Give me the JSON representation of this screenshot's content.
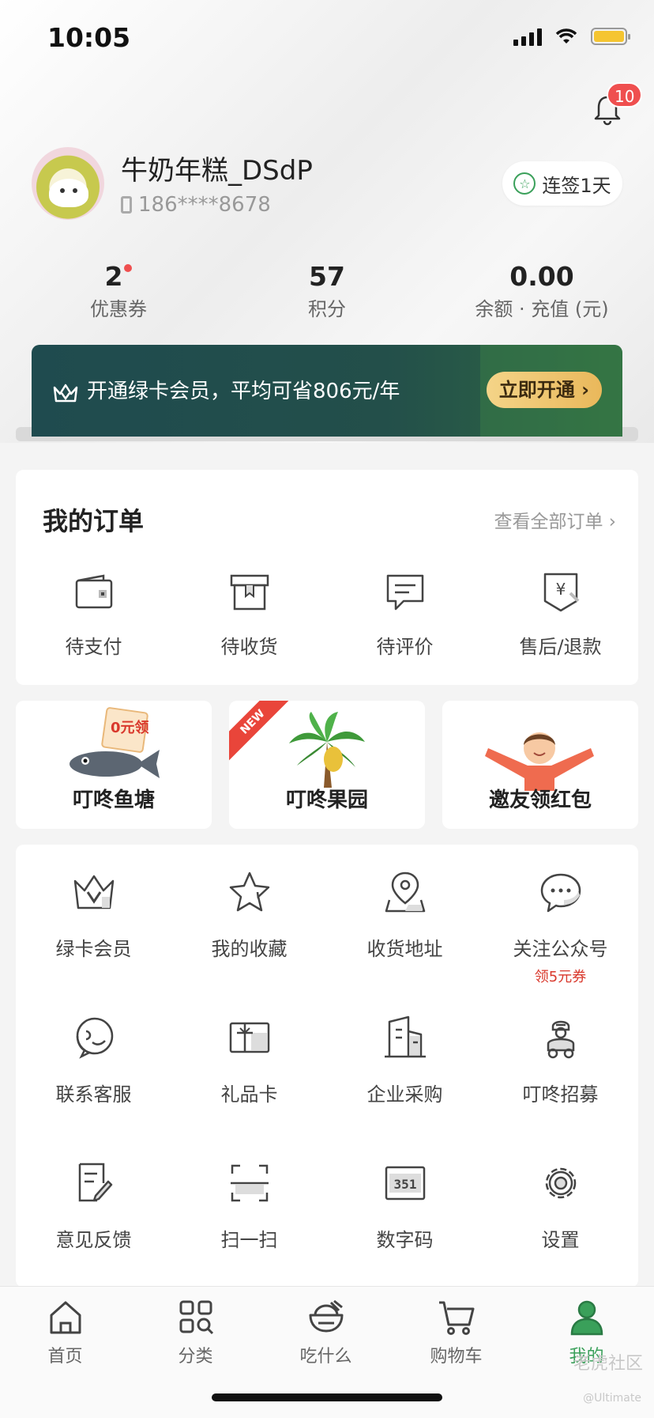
{
  "status_bar": {
    "time": "10:05"
  },
  "notifications": {
    "badge": "10"
  },
  "profile": {
    "name": "牛奶年糕_DSdP",
    "phone": "186****8678",
    "checkin": "连签1天"
  },
  "stats": [
    {
      "value": "2",
      "label": "优惠券",
      "dot": true
    },
    {
      "value": "57",
      "label": "积分"
    },
    {
      "value": "0.00",
      "label": "余额 · 充值 (元)"
    }
  ],
  "member_banner": {
    "text": "开通绿卡会员，平均可省806元/年",
    "button": "立即开通 ›"
  },
  "orders": {
    "title": "我的订单",
    "view_all": "查看全部订单 ›",
    "items": [
      {
        "label": "待支付",
        "icon": "wallet-icon"
      },
      {
        "label": "待收货",
        "icon": "box-icon"
      },
      {
        "label": "待评价",
        "icon": "comment-icon"
      },
      {
        "label": "售后/退款",
        "icon": "refund-icon"
      }
    ]
  },
  "promos": [
    {
      "label": "叮咚鱼塘",
      "badge": "0元领"
    },
    {
      "label": "叮咚果园",
      "tag": "NEW"
    },
    {
      "label": "邀友领红包"
    }
  ],
  "services": [
    {
      "label": "绿卡会员",
      "icon": "crown-icon"
    },
    {
      "label": "我的收藏",
      "icon": "star-icon"
    },
    {
      "label": "收货地址",
      "icon": "location-icon"
    },
    {
      "label": "关注公众号",
      "sub": "领5元券",
      "icon": "wechat-icon"
    },
    {
      "label": "联系客服",
      "icon": "customer-service-icon"
    },
    {
      "label": "礼品卡",
      "icon": "gift-card-icon"
    },
    {
      "label": "企业采购",
      "icon": "building-icon"
    },
    {
      "label": "叮咚招募",
      "icon": "rider-icon"
    },
    {
      "label": "意见反馈",
      "icon": "feedback-icon"
    },
    {
      "label": "扫一扫",
      "icon": "scan-icon"
    },
    {
      "label": "数字码",
      "icon": "digital-code-icon",
      "icon_text": "351"
    },
    {
      "label": "设置",
      "icon": "gear-icon"
    }
  ],
  "tabs": [
    {
      "label": "首页",
      "icon": "home-icon"
    },
    {
      "label": "分类",
      "icon": "category-icon"
    },
    {
      "label": "吃什么",
      "icon": "bowl-icon"
    },
    {
      "label": "购物车",
      "icon": "cart-icon"
    },
    {
      "label": "我的",
      "icon": "profile-icon",
      "active": true
    }
  ],
  "watermark": {
    "text": "老虎社区",
    "sub": "@Ultimate"
  },
  "colors": {
    "accent_green": "#3aa05a",
    "badge_red": "#ef4f4f",
    "banner_dark": "#1f4b4f"
  }
}
